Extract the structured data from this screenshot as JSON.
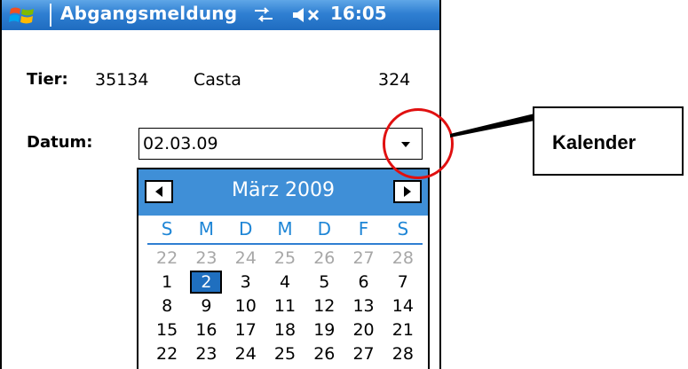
{
  "titlebar": {
    "title": "Abgangsmeldung",
    "time": "16:05",
    "icons": [
      "windows-flag-icon",
      "connectivity-icon",
      "volume-muted-icon"
    ]
  },
  "form": {
    "tier_label": "Tier:",
    "tier_id": "35134",
    "tier_name": "Casta",
    "tier_number": "324",
    "datum_label": "Datum:",
    "datum_value": "02.03.09"
  },
  "calendar": {
    "month_title": "März 2009",
    "weekdays": [
      "S",
      "M",
      "D",
      "M",
      "D",
      "F",
      "S"
    ],
    "rows": [
      [
        "22",
        "23",
        "24",
        "25",
        "26",
        "27",
        "28"
      ],
      [
        "1",
        "2",
        "3",
        "4",
        "5",
        "6",
        "7"
      ],
      [
        "8",
        "9",
        "10",
        "11",
        "12",
        "13",
        "14"
      ],
      [
        "15",
        "16",
        "17",
        "18",
        "19",
        "20",
        "21"
      ],
      [
        "22",
        "23",
        "24",
        "25",
        "26",
        "27",
        "28"
      ]
    ],
    "selected": "2"
  },
  "annotation": {
    "callout_text": "Kalender"
  },
  "colors": {
    "titlebar_blue": "#2f7fd2",
    "calendar_header": "#3f8fd7",
    "weekday_text": "#1f86d6",
    "selected_day": "#1f6fbf",
    "annotation_red": "#e01010"
  }
}
